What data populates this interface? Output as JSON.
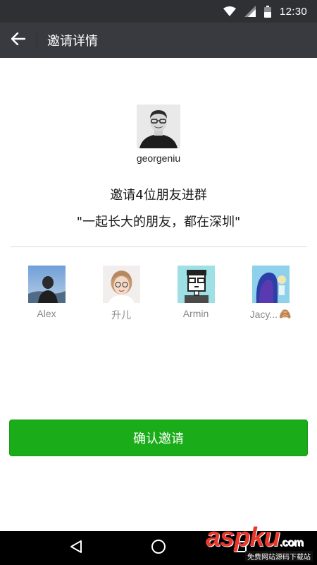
{
  "status_bar": {
    "time": "12:30",
    "icons": [
      "wifi-icon",
      "signal-icon",
      "battery-icon"
    ]
  },
  "title_bar": {
    "title": "邀请详情",
    "back_icon": "arrow-left-icon"
  },
  "owner": {
    "name": "georgeniu"
  },
  "invite": {
    "text": "邀请4位朋友进群",
    "group_name": "\"一起长大的朋友，都在深圳\""
  },
  "friends": [
    {
      "name": "Alex"
    },
    {
      "name": "升儿"
    },
    {
      "name": "Armin"
    },
    {
      "name": "Jacy...",
      "emoji": "🙈"
    }
  ],
  "confirm_button": {
    "label": "确认邀请"
  },
  "nav_bar": {
    "icons": [
      "back-triangle-icon",
      "home-circle-icon",
      "recents-square-icon"
    ]
  },
  "watermark": {
    "brand": "aspku",
    "suffix": ".com",
    "tagline": "免费网站源码下载站"
  },
  "colors": {
    "status_bar": "#2e3033",
    "title_bar": "#393a3f",
    "primary_green": "#1aad19",
    "watermark_red": "#e8372c"
  }
}
